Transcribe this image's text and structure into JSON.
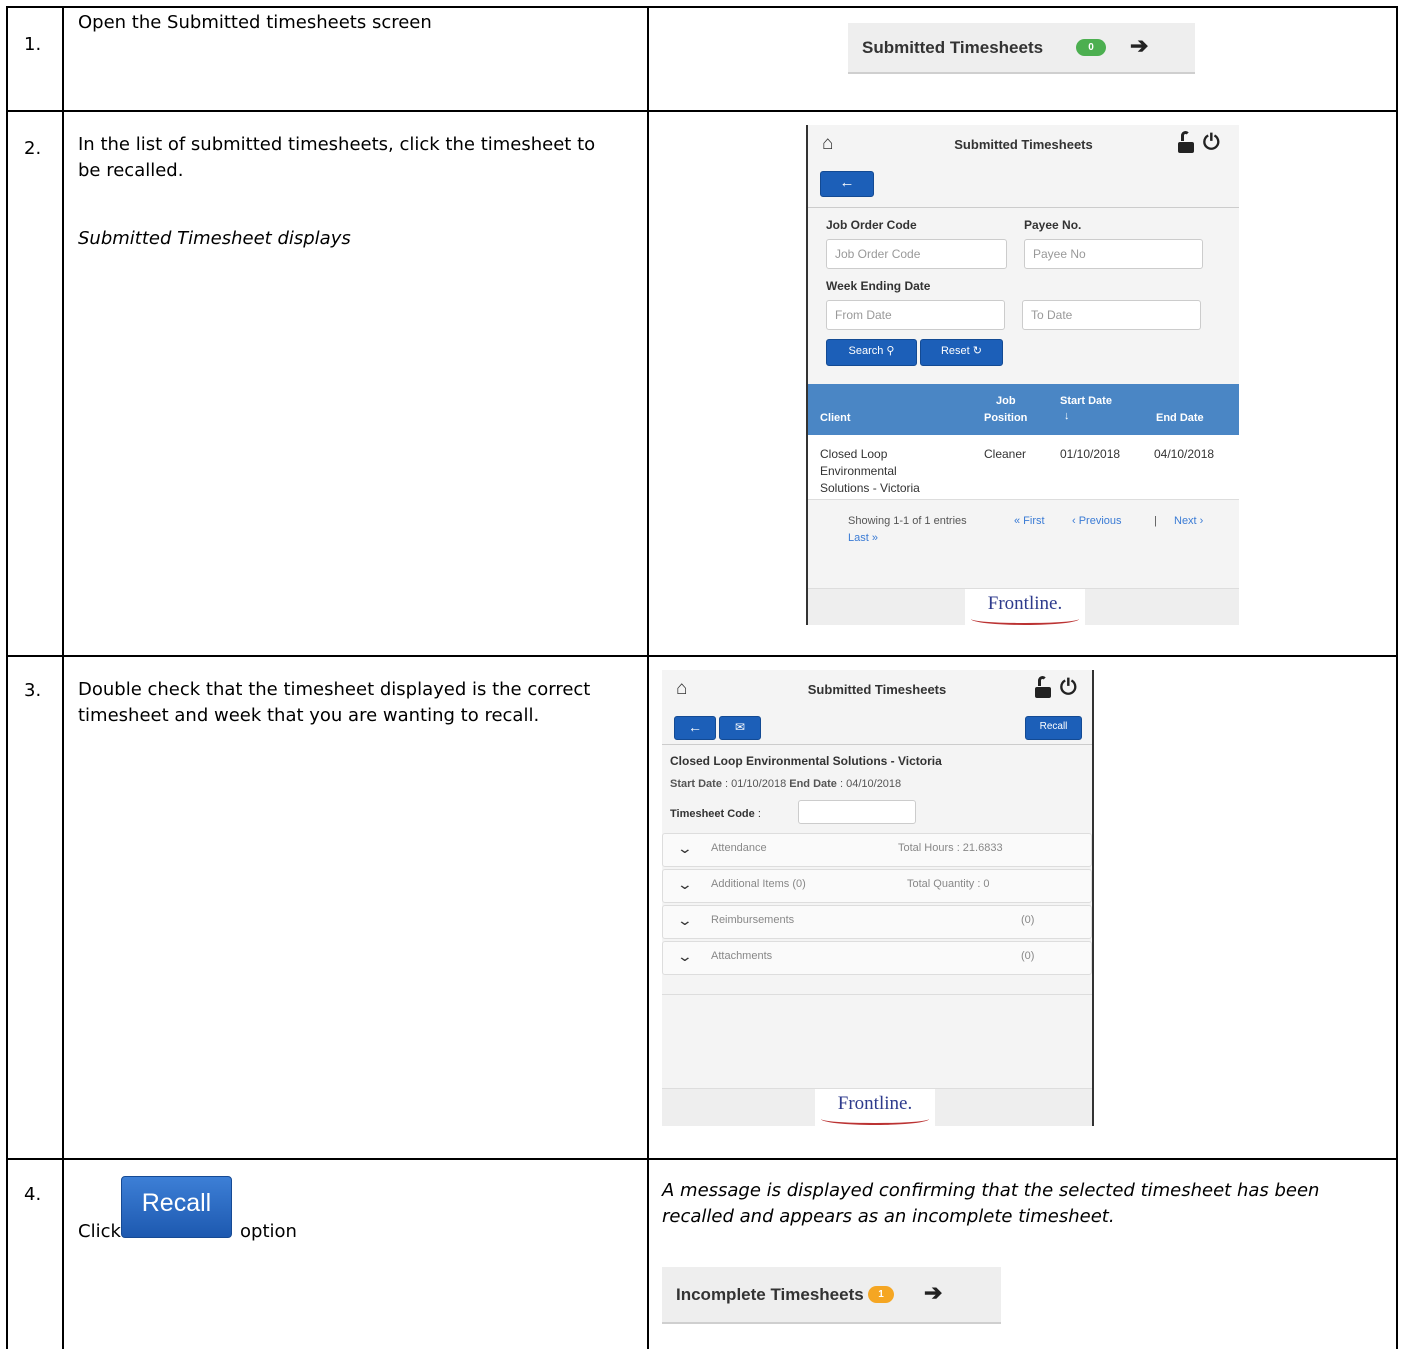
{
  "rows": [
    {
      "num": "1.",
      "text": "Open the Submitted timesheets screen"
    },
    {
      "num": "2.",
      "text": "In the list of submitted timesheets, click the timesheet to be recalled.",
      "note": "Submitted Timesheet displays"
    },
    {
      "num": "3.",
      "text": "Double check that the timesheet displayed is the correct timesheet and week that you are wanting to recall."
    },
    {
      "num": "4.",
      "text_before": "Click",
      "text_after": "option",
      "result": "A message is displayed confirming that the selected timesheet has been recalled and appears as an incomplete timesheet."
    }
  ],
  "submitted_pill": {
    "label": "Submitted Timesheets",
    "count": "0",
    "badge_color": "#4caf50"
  },
  "incomplete_pill": {
    "label": "Incomplete Timesheets",
    "count": "1",
    "badge_color": "#f5a623"
  },
  "recall_button": {
    "label": "Recall"
  },
  "screen2": {
    "title": "Submitted Timesheets",
    "job_order_label": "Job Order Code",
    "job_order_placeholder": "Job Order Code",
    "payee_label": "Payee No.",
    "payee_placeholder": "Payee No",
    "week_label": "Week Ending Date",
    "from_placeholder": "From Date",
    "to_placeholder": "To Date",
    "search_label": "Search",
    "reset_label": "Reset",
    "columns": {
      "client": "Client",
      "job_position_1": "Job",
      "job_position_2": "Position",
      "start_date": "Start Date",
      "end_date": "End Date"
    },
    "row": {
      "client_1": "Closed Loop",
      "client_2": "Environmental",
      "client_3": "Solutions - Victoria",
      "position": "Cleaner",
      "start": "01/10/2018",
      "end": "04/10/2018"
    },
    "pager": {
      "showing": "Showing 1-1 of 1 entries",
      "first": "« First",
      "previous": "‹ Previous",
      "sep": "|",
      "next": "Next ›",
      "last": "Last »"
    },
    "logo": "Frontline."
  },
  "screen3": {
    "title": "Submitted Timesheets",
    "recall_label": "Recall",
    "client": "Closed Loop Environmental Solutions - Victoria",
    "start_label": "Start Date",
    "start_value": " : 01/10/2018 ",
    "end_label": "End Date",
    "end_value": " : 04/10/2018",
    "code_label": "Timesheet Code",
    "code_sep": " :",
    "sections": [
      {
        "label": "Attendance",
        "right": "Total Hours : 21.6833"
      },
      {
        "label": "Additional Items (0)",
        "right": "Total Quantity : 0"
      },
      {
        "label": "Reimbursements",
        "right": "(0)"
      },
      {
        "label": "Attachments",
        "right": "(0)"
      }
    ],
    "logo": "Frontline."
  },
  "icons": [
    "home-icon",
    "unlock-icon",
    "power-icon",
    "back-arrow-icon",
    "envelope-icon",
    "search-icon",
    "refresh-icon",
    "sort-down-icon",
    "chevron-down-icon",
    "arrow-right-icon"
  ]
}
